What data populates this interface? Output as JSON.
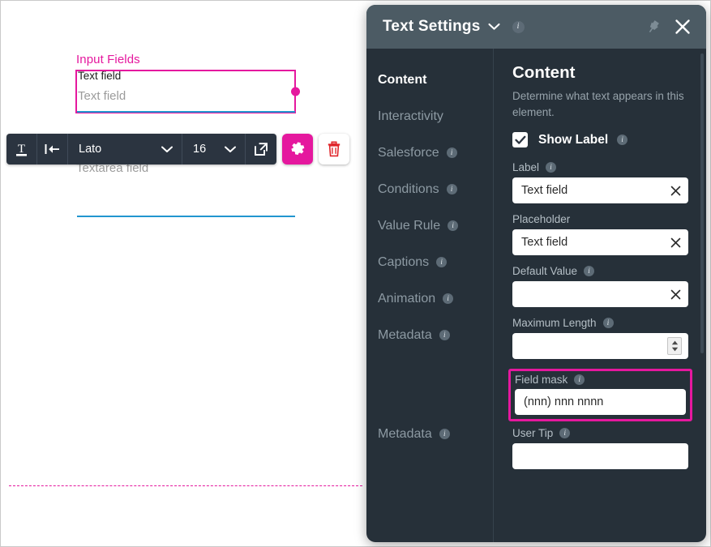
{
  "canvas": {
    "group_title": "Input Fields",
    "text_field": {
      "label": "Text field",
      "placeholder": "Text field"
    },
    "textarea_field": {
      "placeholder": "Textarea field"
    }
  },
  "toolbar": {
    "text_icon": "text-format-icon",
    "align_icon": "indent-left-icon",
    "font_family": "Lato",
    "font_size": "16",
    "popout_icon": "external-link-icon",
    "settings_icon": "gear-icon",
    "delete_icon": "trash-icon",
    "accent": "#e5189e"
  },
  "panel": {
    "header": {
      "title": "Text Settings",
      "chevron_icon": "chevron-down-icon",
      "info_icon": "info-icon",
      "pin_icon": "pin-icon",
      "close_icon": "close-icon"
    },
    "nav": [
      {
        "label": "Content",
        "active": true,
        "info": false
      },
      {
        "label": "Interactivity",
        "active": false,
        "info": false
      },
      {
        "label": "Salesforce",
        "active": false,
        "info": true
      },
      {
        "label": "Conditions",
        "active": false,
        "info": true
      },
      {
        "label": "Value Rule",
        "active": false,
        "info": true
      },
      {
        "label": "Captions",
        "active": false,
        "info": true
      },
      {
        "label": "Animation",
        "active": false,
        "info": true
      },
      {
        "label": "Metadata",
        "active": false,
        "info": true
      },
      {
        "label": "Metadata",
        "active": false,
        "info": true
      }
    ],
    "content": {
      "title": "Content",
      "description": "Determine what text appears in this element.",
      "show_label": {
        "label": "Show Label",
        "checked": true
      },
      "fields": [
        {
          "label": "Label",
          "value": "Text field",
          "placeholder": "",
          "info": true,
          "clear": true,
          "spinner": false,
          "highlighted": false
        },
        {
          "label": "Placeholder",
          "value": "Text field",
          "placeholder": "",
          "info": false,
          "clear": true,
          "spinner": false,
          "highlighted": false
        },
        {
          "label": "Default Value",
          "value": "",
          "placeholder": "",
          "info": true,
          "clear": true,
          "spinner": false,
          "highlighted": false
        },
        {
          "label": "Maximum Length",
          "value": "",
          "placeholder": "",
          "info": true,
          "clear": false,
          "spinner": true,
          "highlighted": false
        },
        {
          "label": "Field mask",
          "value": "(nnn) nnn nnnn",
          "placeholder": "",
          "info": true,
          "clear": false,
          "spinner": false,
          "highlighted": true
        },
        {
          "label": "User Tip",
          "value": "",
          "placeholder": "",
          "info": true,
          "clear": false,
          "spinner": false,
          "highlighted": false
        }
      ]
    }
  },
  "colors": {
    "accent_magenta": "#e5189e",
    "panel_header": "#4c5b64",
    "panel_body": "#263039",
    "toolbar_bg": "#2b3440",
    "field_underline": "#2196cf"
  }
}
